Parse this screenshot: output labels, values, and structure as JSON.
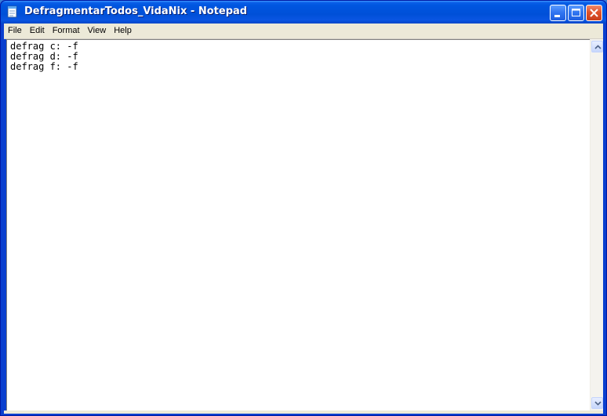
{
  "window": {
    "title": "DefragmentarTodos_VidaNix - Notepad",
    "app_icon": "notepad-icon",
    "controls": {
      "minimize_icon": "minimize-icon",
      "maximize_icon": "maximize-icon",
      "close_icon": "close-icon"
    }
  },
  "menu": {
    "items": [
      "File",
      "Edit",
      "Format",
      "View",
      "Help"
    ]
  },
  "editor": {
    "lines": [
      "defrag c: -f",
      "defrag d: -f",
      "defrag f: -f"
    ]
  },
  "scrollbar": {
    "up_icon": "scroll-up-arrow-icon",
    "down_icon": "scroll-down-arrow-icon"
  },
  "colors": {
    "titlebar": "#0050d8",
    "close_button": "#e0532c",
    "menubar": "#ece9d8",
    "editor_bg": "#ffffff"
  }
}
